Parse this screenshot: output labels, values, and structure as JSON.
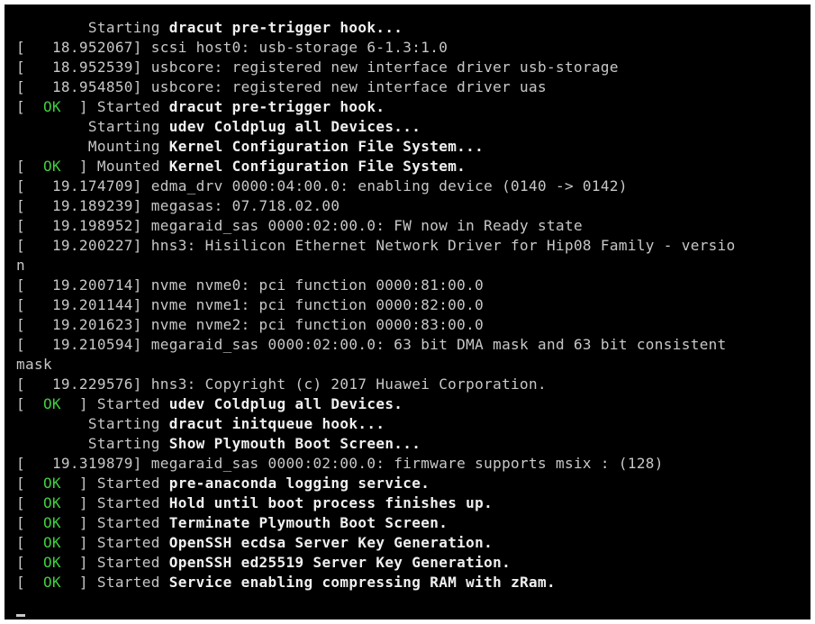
{
  "console": {
    "lines": [
      {
        "type": "status",
        "prefix": "        ",
        "verb": "Starting",
        "subject": "dracut pre-trigger hook..."
      },
      {
        "type": "kernel",
        "prefix": "[   ",
        "timestamp": "18.952067]",
        "text": "scsi host0: usb-storage 6-1.3:1.0"
      },
      {
        "type": "kernel",
        "prefix": "[   ",
        "timestamp": "18.952539]",
        "text": "usbcore: registered new interface driver usb-storage"
      },
      {
        "type": "kernel",
        "prefix": "[   ",
        "timestamp": "18.954850]",
        "text": "usbcore: registered new interface driver uas"
      },
      {
        "type": "ok",
        "open": "[  ",
        "ok": "OK",
        "close": "  ]",
        "verb": "Started",
        "subject": "dracut pre-trigger hook."
      },
      {
        "type": "status",
        "prefix": "        ",
        "verb": "Starting",
        "subject": "udev Coldplug all Devices..."
      },
      {
        "type": "status",
        "prefix": "        ",
        "verb": "Mounting",
        "subject": "Kernel Configuration File System..."
      },
      {
        "type": "ok",
        "open": "[  ",
        "ok": "OK",
        "close": "  ]",
        "verb": "Mounted",
        "subject": "Kernel Configuration File System."
      },
      {
        "type": "kernel",
        "prefix": "[   ",
        "timestamp": "19.174709]",
        "text": "edma_drv 0000:04:00.0: enabling device (0140 -> 0142)"
      },
      {
        "type": "kernel",
        "prefix": "[   ",
        "timestamp": "19.189239]",
        "text": "megasas: 07.718.02.00"
      },
      {
        "type": "kernel",
        "prefix": "[   ",
        "timestamp": "19.198952]",
        "text": "megaraid_sas 0000:02:00.0: FW now in Ready state"
      },
      {
        "type": "kernel",
        "prefix": "[   ",
        "timestamp": "19.200227]",
        "text": "hns3: Hisilicon Ethernet Network Driver for Hip08 Family - versio"
      },
      {
        "type": "plain",
        "text": "n"
      },
      {
        "type": "kernel",
        "prefix": "[   ",
        "timestamp": "19.200714]",
        "text": "nvme nvme0: pci function 0000:81:00.0"
      },
      {
        "type": "kernel",
        "prefix": "[   ",
        "timestamp": "19.201144]",
        "text": "nvme nvme1: pci function 0000:82:00.0"
      },
      {
        "type": "kernel",
        "prefix": "[   ",
        "timestamp": "19.201623]",
        "text": "nvme nvme2: pci function 0000:83:00.0"
      },
      {
        "type": "kernel",
        "prefix": "[   ",
        "timestamp": "19.210594]",
        "text": "megaraid_sas 0000:02:00.0: 63 bit DMA mask and 63 bit consistent"
      },
      {
        "type": "plain",
        "text": "mask"
      },
      {
        "type": "kernel",
        "prefix": "[   ",
        "timestamp": "19.229576]",
        "text": "hns3: Copyright (c) 2017 Huawei Corporation."
      },
      {
        "type": "ok",
        "open": "[  ",
        "ok": "OK",
        "close": "  ]",
        "verb": "Started",
        "subject": "udev Coldplug all Devices."
      },
      {
        "type": "status",
        "prefix": "        ",
        "verb": "Starting",
        "subject": "dracut initqueue hook..."
      },
      {
        "type": "status",
        "prefix": "        ",
        "verb": "Starting",
        "subject": "Show Plymouth Boot Screen..."
      },
      {
        "type": "kernel",
        "prefix": "[   ",
        "timestamp": "19.319879]",
        "text": "megaraid_sas 0000:02:00.0: firmware supports msix : (128)"
      },
      {
        "type": "ok",
        "open": "[  ",
        "ok": "OK",
        "close": "  ]",
        "verb": "Started",
        "subject": "pre-anaconda logging service."
      },
      {
        "type": "ok",
        "open": "[  ",
        "ok": "OK",
        "close": "  ]",
        "verb": "Started",
        "subject": "Hold until boot process finishes up."
      },
      {
        "type": "ok",
        "open": "[  ",
        "ok": "OK",
        "close": "  ]",
        "verb": "Started",
        "subject": "Terminate Plymouth Boot Screen."
      },
      {
        "type": "ok",
        "open": "[  ",
        "ok": "OK",
        "close": "  ]",
        "verb": "Started",
        "subject": "OpenSSH ecdsa Server Key Generation."
      },
      {
        "type": "ok",
        "open": "[  ",
        "ok": "OK",
        "close": "  ]",
        "verb": "Started",
        "subject": "OpenSSH ed25519 Server Key Generation."
      },
      {
        "type": "ok",
        "open": "[  ",
        "ok": "OK",
        "close": "  ]",
        "verb": "Started",
        "subject": "Service enabling compressing RAM with zRam."
      }
    ],
    "cursor": "_"
  },
  "colors": {
    "background": "#000000",
    "text": "#c8c8c8",
    "highlight": "#f0f0f0",
    "ok_green": "#3fcf3f"
  }
}
